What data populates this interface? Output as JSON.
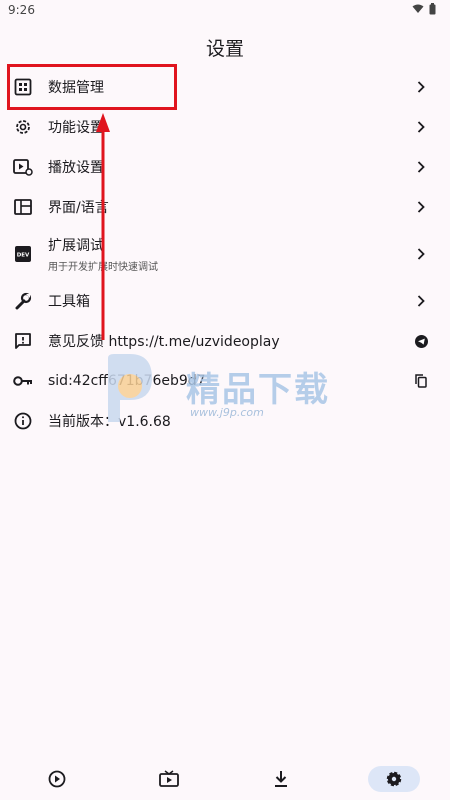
{
  "status": {
    "time": "9:26"
  },
  "header": {
    "title": "设置"
  },
  "menu": {
    "items": [
      {
        "label": "数据管理"
      },
      {
        "label": "功能设置"
      },
      {
        "label": "播放设置"
      },
      {
        "label": "界面/语言"
      },
      {
        "label": "扩展调试",
        "sub": "用于开发扩展时快速调试"
      },
      {
        "label": "工具箱"
      },
      {
        "label": "意见反馈 https://t.me/uzvideoplay"
      },
      {
        "label": "sid:42cff671b76eb9d7"
      },
      {
        "label": "当前版本：v1.6.68"
      }
    ]
  },
  "watermark": {
    "title": "精品下载",
    "url": "www.j9p.com"
  },
  "icons": {
    "status": [
      "wifi-icon",
      "battery-icon"
    ],
    "menu": [
      "grid-icon",
      "gear-icon",
      "play-settings-icon",
      "layout-icon",
      "dev-icon",
      "wrench-icon",
      "feedback-icon",
      "key-icon",
      "info-icon"
    ],
    "trail": [
      "chevron-right-icon",
      "telegram-icon",
      "copy-icon"
    ],
    "nav": [
      "play-circle-icon",
      "tv-icon",
      "download-icon",
      "settings-icon"
    ]
  },
  "colors": {
    "background": "#fdf8fb",
    "highlight": "#e0141e",
    "nav_active": "#dde6f7",
    "text": "#1c1b1f"
  }
}
